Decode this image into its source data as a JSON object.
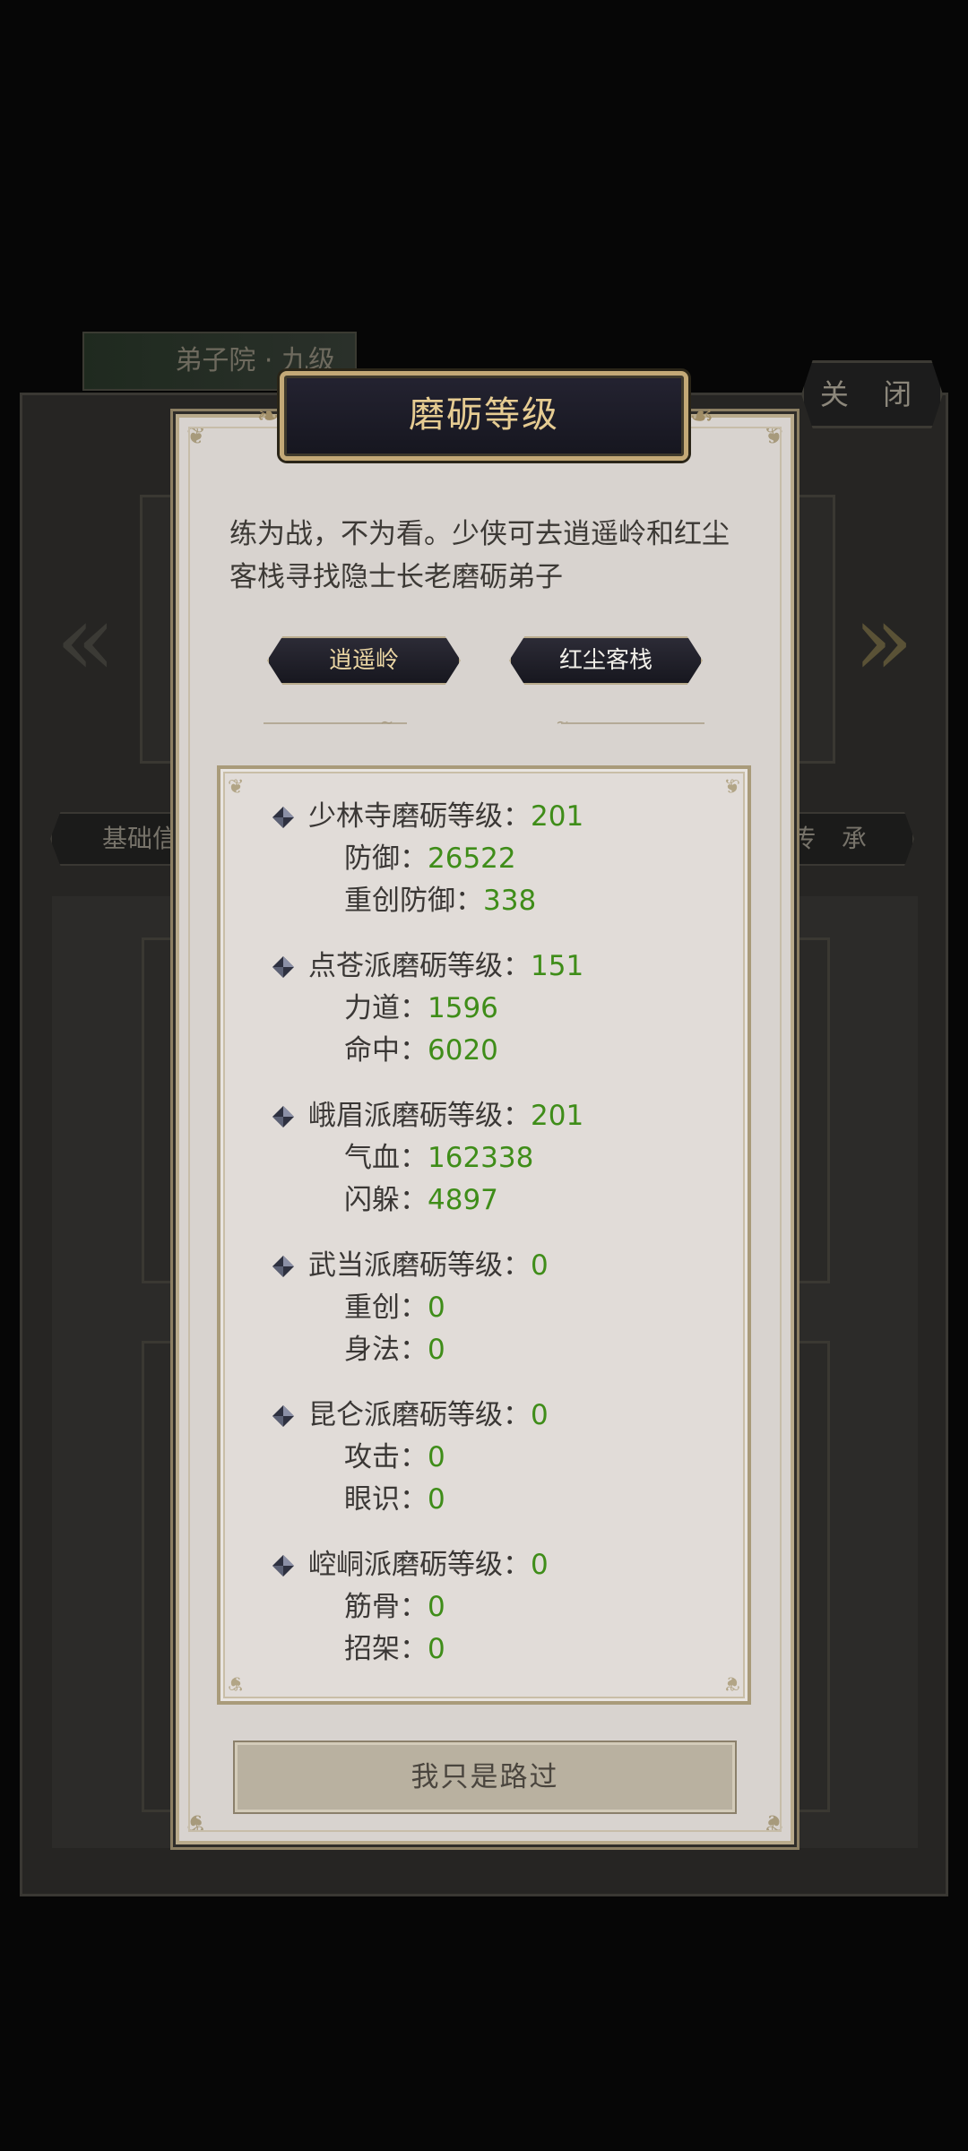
{
  "background": {
    "banner_text": "弟子院 · 九级",
    "close_label": "关 闭",
    "tab_left": "基础信息",
    "tab_right": "传 承"
  },
  "modal": {
    "title": "磨砺等级",
    "description": "练为战，不为看。少侠可去逍遥岭和红尘客栈寻找隐士长老磨砺弟子",
    "buttons": [
      "逍遥岭",
      "红尘客栈"
    ],
    "sects": [
      {
        "name": "少林寺磨砺等级：",
        "level": "201",
        "stats": [
          {
            "label": "防御：",
            "value": "26522"
          },
          {
            "label": "重创防御：",
            "value": "338"
          }
        ]
      },
      {
        "name": "点苍派磨砺等级：",
        "level": "151",
        "stats": [
          {
            "label": "力道：",
            "value": "1596"
          },
          {
            "label": "命中：",
            "value": "6020"
          }
        ]
      },
      {
        "name": "峨眉派磨砺等级：",
        "level": "201",
        "stats": [
          {
            "label": "气血：",
            "value": "162338"
          },
          {
            "label": "闪躲：",
            "value": "4897"
          }
        ]
      },
      {
        "name": "武当派磨砺等级：",
        "level": "0",
        "stats": [
          {
            "label": "重创：",
            "value": "0"
          },
          {
            "label": "身法：",
            "value": "0"
          }
        ]
      },
      {
        "name": "昆仑派磨砺等级：",
        "level": "0",
        "stats": [
          {
            "label": "攻击：",
            "value": "0"
          },
          {
            "label": "眼识：",
            "value": "0"
          }
        ]
      },
      {
        "name": "崆峒派磨砺等级：",
        "level": "0",
        "stats": [
          {
            "label": "筋骨：",
            "value": "0"
          },
          {
            "label": "招架：",
            "value": "0"
          }
        ]
      }
    ],
    "dismiss_label": "我只是路过"
  },
  "colors": {
    "value_green": "#3f8d19",
    "title_gold": "#e6cc92",
    "panel_bg": "#d8d3cf"
  }
}
